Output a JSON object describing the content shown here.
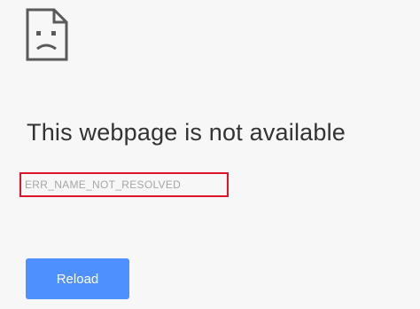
{
  "error_page": {
    "icon": "sad-page-icon",
    "heading": "This webpage is not available",
    "error_code": "ERR_NAME_NOT_RESOLVED",
    "reload_label": "Reload",
    "highlight_color": "#e0152b",
    "button_color": "#4d90fe"
  }
}
